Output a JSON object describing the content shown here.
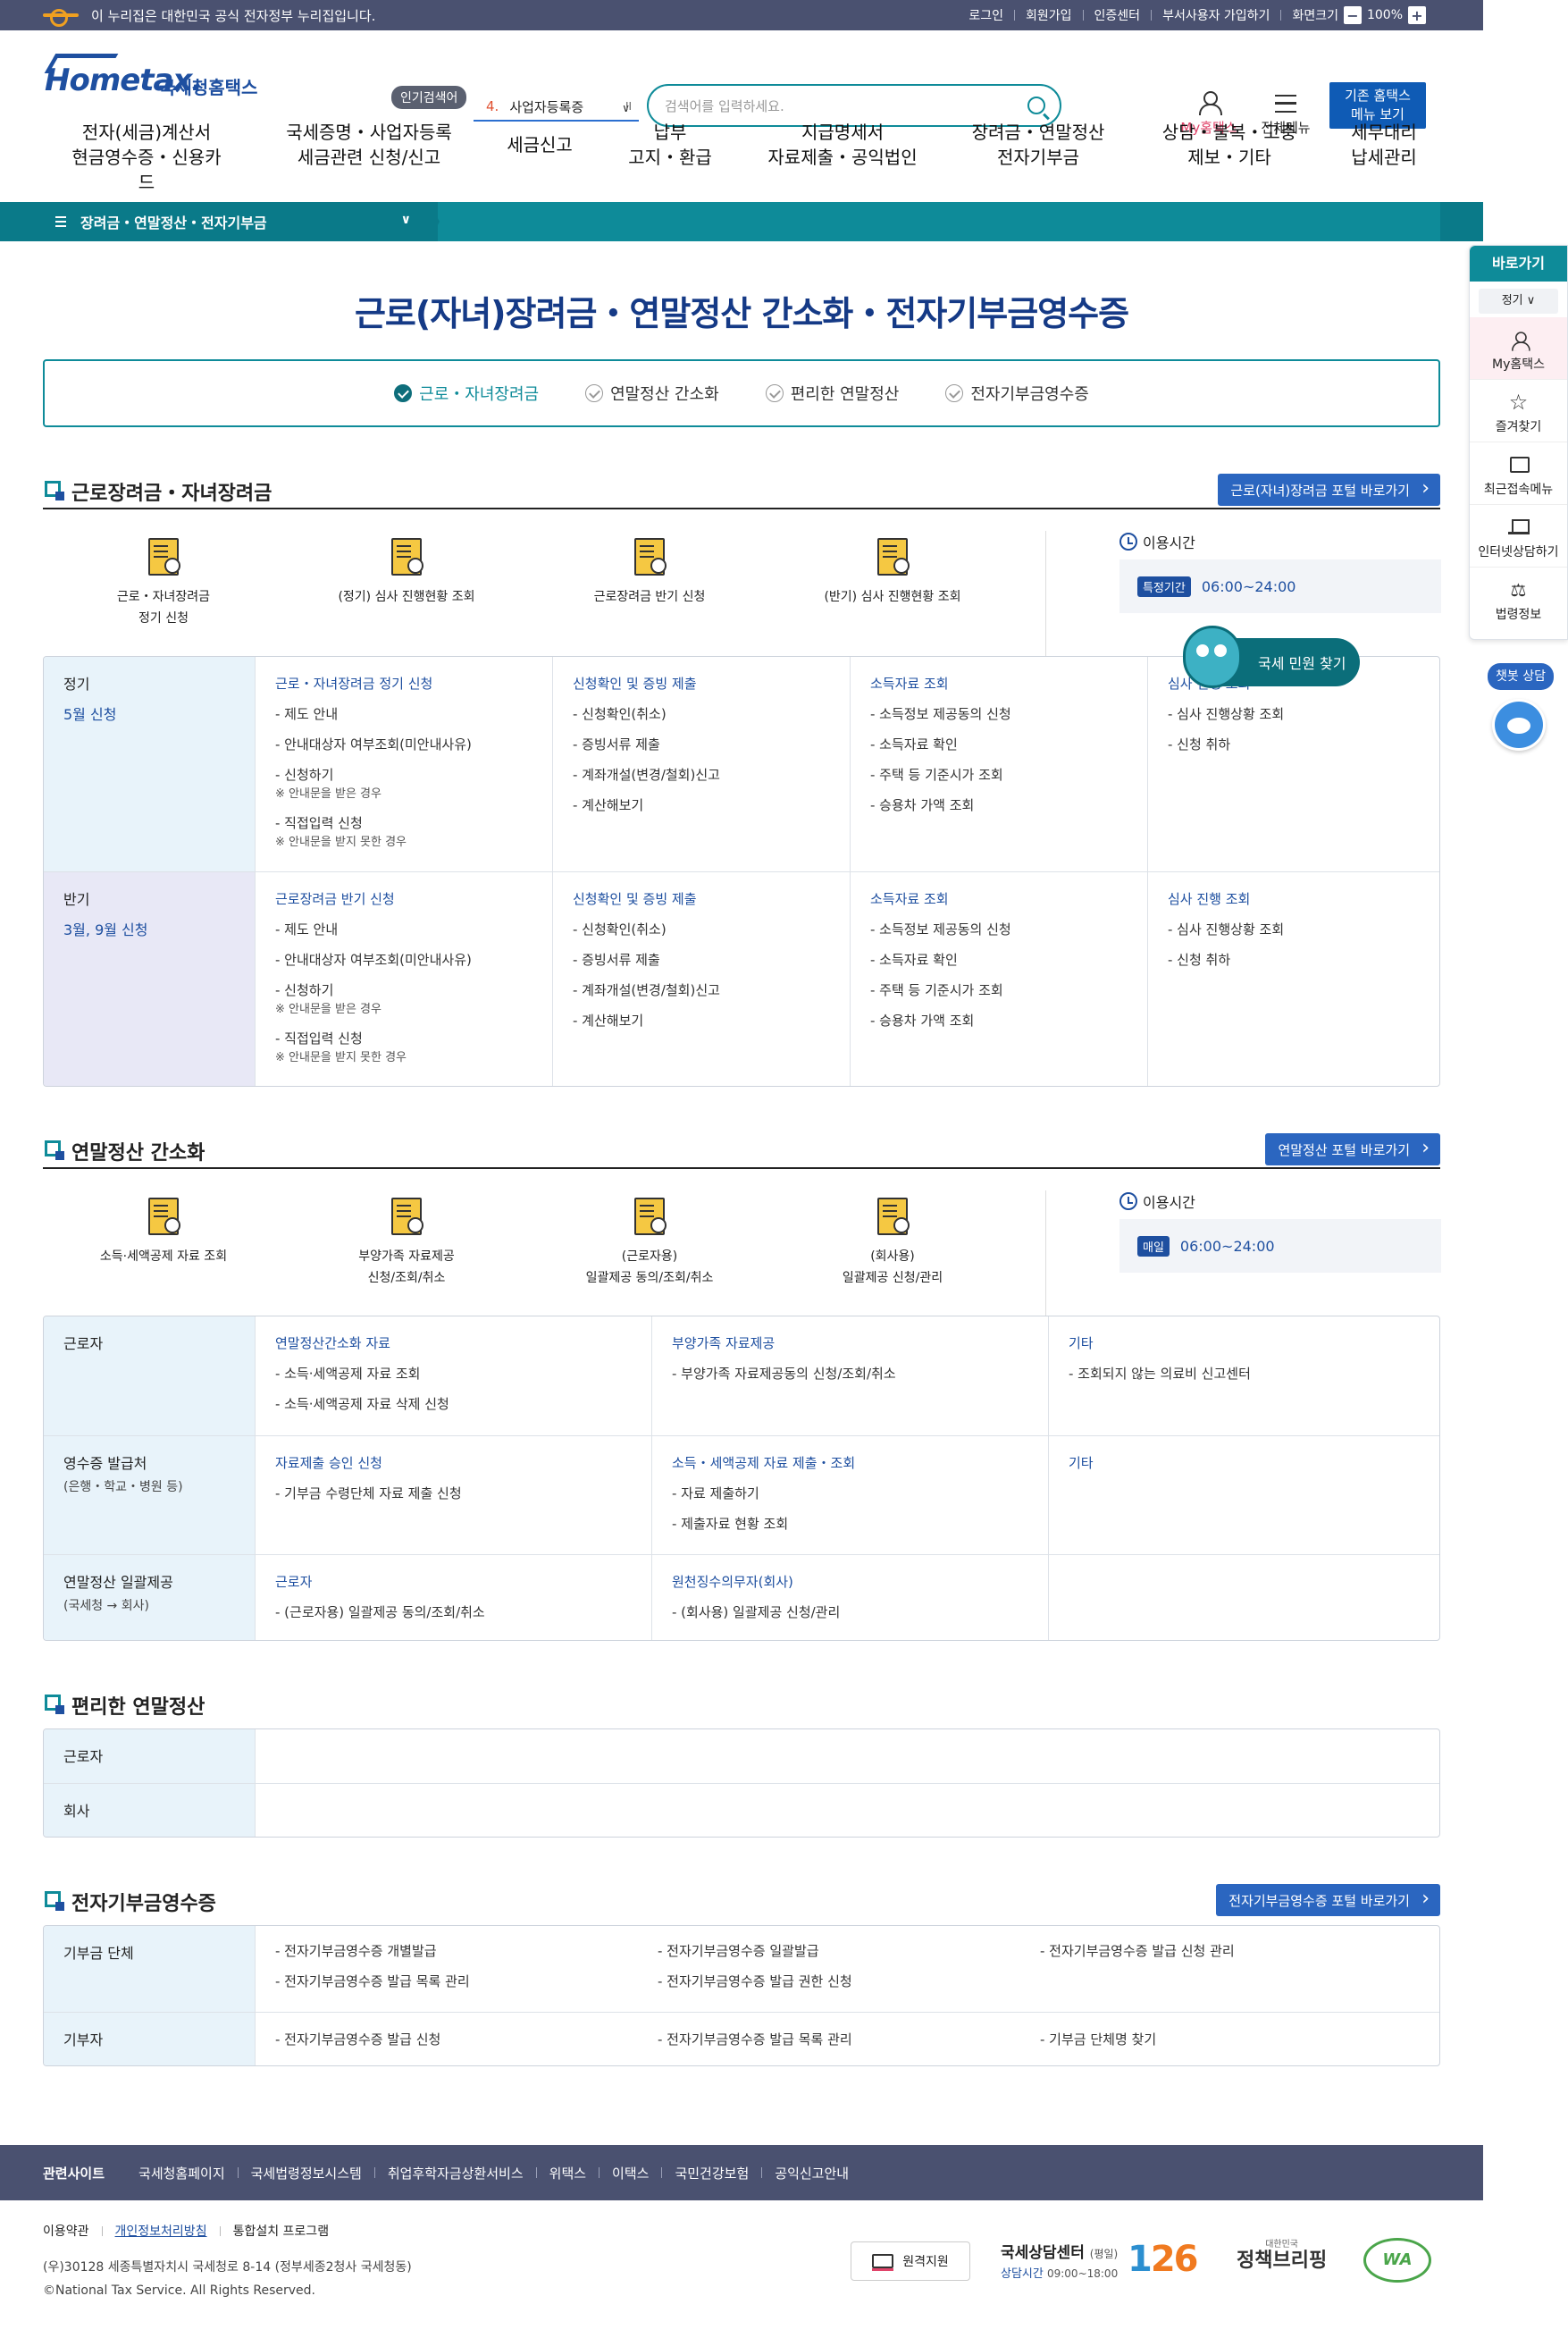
{
  "topbar": {
    "notice": "이 누리집은 대한민국 공식 전자정부 누리집입니다.",
    "login": "로그인",
    "signup": "회원가입",
    "cert": "인증센터",
    "dept_signup": "부서사용자 가입하기",
    "zoom_label": "화면크기",
    "zoom_minus": "−",
    "zoom_value": "100%",
    "zoom_plus": "+"
  },
  "header": {
    "logo_text": "Hometax.",
    "logo_kr": "국세청홈택스",
    "popular_label": "인기검색어",
    "popular_num": "4.",
    "popular_term": "사업자등록증",
    "popular_ctrl": "II",
    "search_placeholder": "검색어를 입력하세요.",
    "myhometax": "My홈택스",
    "allmenu": "전체메뉴",
    "old_hometax_1": "기존 홈택스",
    "old_hometax_2": "메뉴 보기"
  },
  "gnb": [
    {
      "l1": "전자(세금)계산서",
      "l2": "현금영수증・신용카드"
    },
    {
      "l1": "국세증명・사업자등록",
      "l2": "세금관련 신청/신고"
    },
    {
      "l1": "세금신고",
      "l2": ""
    },
    {
      "l1": "납부",
      "l2": "고지・환급"
    },
    {
      "l1": "지급명세서",
      "l2": "자료제출・공익법인"
    },
    {
      "l1": "장려금・연말정산",
      "l2": "전자기부금"
    },
    {
      "l1": "상담・불복・고충",
      "l2": "제보・기타"
    },
    {
      "l1": "세무대리",
      "l2": "납세관리"
    }
  ],
  "section_bar": {
    "current": "장려금・연말정산・전자기부금"
  },
  "page": {
    "title": "근로(자녀)장려금・연말정산 간소화・전자기부금영수증",
    "tabs": [
      "근로・자녀장려금",
      "연말정산 간소화",
      "편리한 연말정산",
      "전자기부금영수증"
    ]
  },
  "sec1": {
    "title": "근로장려금・자녀장려금",
    "portal": "근로(자녀)장려금 포털 바로가기",
    "quick": [
      {
        "l1": "근로・자녀장려금",
        "l2": "정기 신청"
      },
      {
        "l1": "(정기) 심사 진행현황 조회",
        "l2": ""
      },
      {
        "l1": "근로장려금 반기 신청",
        "l2": ""
      },
      {
        "l1": "(반기) 심사 진행현황 조회",
        "l2": ""
      }
    ],
    "use_label": "이용시간",
    "use_badge": "특정기간",
    "use_time": "06:00~24:00",
    "rows": [
      {
        "th": "정기",
        "sub": "5월 신청",
        "c1": {
          "h": "근로・자녀장려금 정기 신청",
          "items": [
            "- 제도 안내",
            "- 안내대상자 여부조회(미안내사유)",
            "- 신청하기",
            "- 직접입력 신청"
          ],
          "notes": [
            "※ 안내문을 받은 경우",
            "※ 안내문을 받지 못한 경우"
          ]
        },
        "c2": {
          "h": "신청확인 및 증빙 제출",
          "items": [
            "- 신청확인(취소)",
            "- 증빙서류 제출",
            "- 계좌개설(변경/철회)신고",
            "- 계산해보기"
          ]
        },
        "c3": {
          "h": "소득자료 조회",
          "items": [
            "- 소득정보 제공동의 신청",
            "- 소득자료 확인",
            "- 주택 등 기준시가 조회",
            "- 승용차 가액 조회"
          ]
        },
        "c4": {
          "h": "심사 진행 조회",
          "items": [
            "- 심사 진행상황 조회",
            "- 신청 취하"
          ]
        }
      },
      {
        "th": "반기",
        "sub": "3월, 9월 신청",
        "c1": {
          "h": "근로장려금 반기 신청",
          "items": [
            "- 제도 안내",
            "- 안내대상자 여부조회(미안내사유)",
            "- 신청하기",
            "- 직접입력 신청"
          ],
          "notes": [
            "※ 안내문을 받은 경우",
            "※ 안내문을 받지 못한 경우"
          ]
        },
        "c2": {
          "h": "신청확인 및 증빙 제출",
          "items": [
            "- 신청확인(취소)",
            "- 증빙서류 제출",
            "- 계좌개설(변경/철회)신고",
            "- 계산해보기"
          ]
        },
        "c3": {
          "h": "소득자료 조회",
          "items": [
            "- 소득정보 제공동의 신청",
            "- 소득자료 확인",
            "- 주택 등 기준시가 조회",
            "- 승용차 가액 조회"
          ]
        },
        "c4": {
          "h": "심사 진행 조회",
          "items": [
            "- 심사 진행상황 조회",
            "- 신청 취하"
          ]
        }
      }
    ]
  },
  "floating_cta": "국세 민원 찾기",
  "sec2": {
    "title": "연말정산 간소화",
    "portal": "연말정산 포털 바로가기",
    "quick": [
      {
        "l1": "소득·세액공제 자료 조회",
        "l2": ""
      },
      {
        "l1": "부양가족 자료제공",
        "l2": "신청/조회/취소"
      },
      {
        "l1": "(근로자용)",
        "l2": "일괄제공 동의/조회/취소"
      },
      {
        "l1": "(회사용)",
        "l2": "일괄제공 신청/관리"
      }
    ],
    "use_label": "이용시간",
    "use_badge": "매일",
    "use_time": "06:00~24:00",
    "rows": [
      {
        "th": "근로자",
        "sm": "",
        "c1": {
          "h": "연말정산간소화 자료",
          "items": [
            "- 소득·세액공제 자료 조회",
            "- 소득·세액공제 자료 삭제 신청"
          ]
        },
        "c2": {
          "h": "부양가족 자료제공",
          "items": [
            "- 부양가족 자료제공동의 신청/조회/취소"
          ]
        },
        "c3": {
          "h": "기타",
          "items": [
            "- 조회되지 않는 의료비 신고센터"
          ]
        }
      },
      {
        "th": "영수증 발급처",
        "sm": "(은행・학교・병원 등)",
        "c1": {
          "h": "자료제출 승인 신청",
          "items": [
            "- 기부금 수령단체 자료 제출 신청"
          ]
        },
        "c2": {
          "h": "소득・세액공제 자료 제출・조회",
          "items": [
            "- 자료 제출하기",
            "- 제출자료 현황 조회"
          ]
        },
        "c3": {
          "h": "기타",
          "items": []
        }
      },
      {
        "th": "연말정산 일괄제공",
        "sm": "(국세청 → 회사)",
        "c1": {
          "h": "근로자",
          "items": [
            "- (근로자용) 일괄제공 동의/조회/취소"
          ]
        },
        "c2": {
          "h": "원천징수의무자(회사)",
          "items": [
            "- (회사용) 일괄제공 신청/관리"
          ]
        },
        "c3": {
          "h": "",
          "items": []
        }
      }
    ]
  },
  "sec3": {
    "title": "편리한 연말정산",
    "rows": [
      "근로자",
      "회사"
    ]
  },
  "sec4": {
    "title": "전자기부금영수증",
    "portal": "전자기부금영수증 포털 바로가기",
    "rows": [
      {
        "th": "기부금 단체",
        "cols": [
          [
            "- 전자기부금영수증 개별발급",
            "- 전자기부금영수증 발급 목록 관리"
          ],
          [
            "- 전자기부금영수증 일괄발급",
            "- 전자기부금영수증 발급 권한 신청"
          ],
          [
            "- 전자기부금영수증 발급 신청 관리"
          ]
        ]
      },
      {
        "th": "기부자",
        "cols": [
          [
            "- 전자기부금영수증 발급 신청"
          ],
          [
            "- 전자기부금영수증 발급 목록 관리"
          ],
          [
            "- 기부금 단체명 찾기"
          ]
        ]
      }
    ]
  },
  "quickbar": {
    "title": "바로가기",
    "select": "정기 ∨",
    "items": [
      "My홈택스",
      "즐겨찾기",
      "최근접속메뉴",
      "인터넷상담하기",
      "법령정보"
    ],
    "chat": "챗봇 상담"
  },
  "footer": {
    "related": "관련사이트",
    "links": [
      "국세청홈페이지",
      "국세법령정보시스템",
      "취업후학자금상환서비스",
      "위택스",
      "이택스",
      "국민건강보험",
      "공익신고안내"
    ],
    "terms": "이용약관",
    "privacy": "개인정보처리방침",
    "install": "통합설치 프로그램",
    "address": "(우)30128 세종특별자치시 국세청로 8-14 (정부세종2청사 국세청동)",
    "copyright": "©National Tax Service. All Rights Reserved.",
    "remote": "원격지원",
    "call_center": "국세상담센터",
    "call_week": "(평일)",
    "call_hours_label": "상담시간",
    "call_hours": "09:00~18:00",
    "call_number_a": "1",
    "call_number_b": "26",
    "policy_small": "대한민국",
    "policy": "정책브리핑",
    "wa": "WA"
  }
}
